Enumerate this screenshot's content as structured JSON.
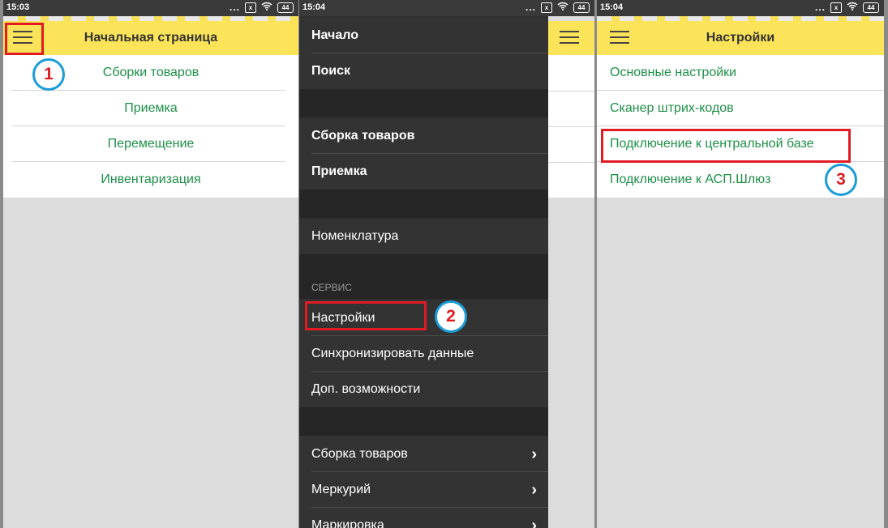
{
  "colors": {
    "accent_yellow": "#fbe459",
    "link_green": "#1d8f47",
    "highlight_red": "#e01b24",
    "step_blue": "#1a9cd8",
    "drawer_bg": "#303030"
  },
  "status_icons": {
    "dots": "...",
    "sim": "x",
    "battery": "44"
  },
  "screen1": {
    "time": "15:03",
    "title": "Начальная страница",
    "items": [
      "Сборки товаров",
      "Приемка",
      "Перемещение",
      "Инвентаризация"
    ],
    "step": "1"
  },
  "screen2": {
    "time": "15:04",
    "group1": [
      "Начало",
      "Поиск"
    ],
    "group2": [
      "Сборка товаров",
      "Приемка"
    ],
    "group3": [
      "Номенклатура"
    ],
    "service_header": "СЕРВИС",
    "service": [
      "Настройки",
      "Синхронизировать данные",
      "Доп. возможности"
    ],
    "submenus": [
      "Сборка товаров",
      "Меркурий",
      "Маркировка"
    ],
    "chevron": "›",
    "step": "2"
  },
  "screen3": {
    "time": "15:04",
    "title": "Настройки",
    "items": [
      "Основные настройки",
      "Сканер штрих-кодов",
      "Подключение к центральной базе",
      "Подключение к АСП.Шлюз"
    ],
    "step": "3"
  }
}
